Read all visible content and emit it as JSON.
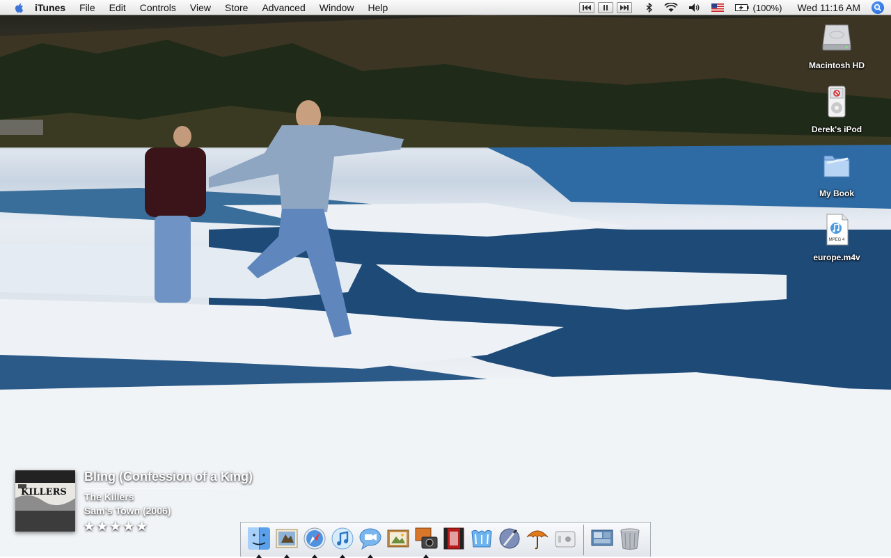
{
  "menubar": {
    "app_name": "iTunes",
    "items": [
      "File",
      "Edit",
      "Controls",
      "View",
      "Store",
      "Advanced",
      "Window",
      "Help"
    ],
    "battery": "(100%)",
    "clock": "Wed 11:16 AM"
  },
  "desktop_icons": [
    {
      "label": "Macintosh HD",
      "icon": "hard-drive-icon"
    },
    {
      "label": "Derek's iPod",
      "icon": "ipod-icon"
    },
    {
      "label": "My Book",
      "icon": "folder-icon"
    },
    {
      "label": "europe.m4v",
      "icon": "mpeg4-file-icon",
      "badge": "MPEG 4"
    }
  ],
  "now_playing": {
    "title": "Bling (Confession of a King)",
    "artist": "The Killers",
    "album": "Sam's Town (2006)",
    "rating": 5,
    "stars": "★★★★★",
    "art_text": "KILLERS"
  },
  "dock": {
    "apps": [
      {
        "name": "finder-icon",
        "running": true
      },
      {
        "name": "mail-icon",
        "running": true
      },
      {
        "name": "safari-icon",
        "running": true
      },
      {
        "name": "itunes-icon",
        "running": true
      },
      {
        "name": "ichat-icon",
        "running": true
      },
      {
        "name": "iphoto-icon",
        "running": false
      },
      {
        "name": "image-capture-icon",
        "running": true
      },
      {
        "name": "imovie-icon",
        "running": false
      },
      {
        "name": "iweb-icon",
        "running": false
      },
      {
        "name": "script-editor-icon",
        "running": false
      },
      {
        "name": "umbrella-icon",
        "running": false
      },
      {
        "name": "apple-tv-icon",
        "running": false
      }
    ],
    "others": [
      {
        "name": "desktop-picture-icon"
      },
      {
        "name": "trash-icon"
      }
    ]
  },
  "colors": {
    "accent": "#1c5fd8",
    "menubar_bg": "#f0f0f0",
    "sky_ice": "#dfe6ee",
    "water": "#1e4a78"
  }
}
